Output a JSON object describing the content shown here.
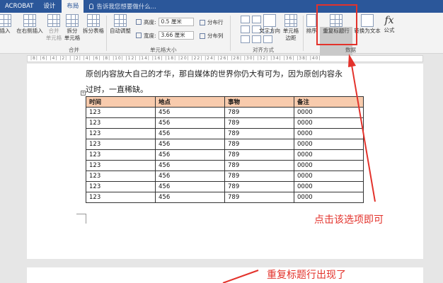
{
  "tabs": [
    {
      "label": "ACROBAT",
      "active": false
    },
    {
      "label": "设计",
      "active": false
    },
    {
      "label": "布局",
      "active": true
    }
  ],
  "search_placeholder": "告诉我您想要做什么...",
  "ribbon": {
    "insert_left": "插入",
    "insert_right": "在右侧插入",
    "merge_cells": [
      "合并",
      "单元格"
    ],
    "split_cells": [
      "拆分",
      "单元格"
    ],
    "split_table": "拆分表格",
    "group_merge": "合并",
    "autofit": "自动调整",
    "height_label": "高度:",
    "height_value": "0.5 厘米",
    "width_label": "宽度:",
    "width_value": "3.66 厘米",
    "distribute_rows": "分布行",
    "distribute_cols": "分布列",
    "group_cell_size": "单元格大小",
    "text_direction": "文字方向",
    "cell_margins": [
      "单元格",
      "边距"
    ],
    "group_alignment": "对齐方式",
    "sort": "排序",
    "repeat_header": "重复标题行",
    "convert_text": "转换为文本",
    "formula": "公式",
    "formula_glyph": "fx",
    "group_data": "数据"
  },
  "document": {
    "line1": "原创内容放大自己的才华，那自媒体的世界你仍大有可为，因为原创内容永",
    "line2": "过时，一直稀缺。",
    "table": {
      "headers": [
        "时间",
        "地点",
        "事物",
        "备注"
      ],
      "rows": [
        [
          "123",
          "456",
          "789",
          "0000"
        ],
        [
          "123",
          "456",
          "789",
          "0000"
        ],
        [
          "123",
          "456",
          "789",
          "0000"
        ],
        [
          "123",
          "456",
          "789",
          "0000"
        ],
        [
          "123",
          "456",
          "789",
          "0000"
        ],
        [
          "123",
          "456",
          "789",
          "0000"
        ],
        [
          "123",
          "456",
          "789",
          "0000"
        ],
        [
          "123",
          "456",
          "789",
          "0000"
        ],
        [
          "123",
          "456",
          "789",
          "0000"
        ]
      ]
    }
  },
  "annotations": {
    "click_hint": "点击该选项即可",
    "result_hint": "重复标题行出现了"
  },
  "colors": {
    "accent": "#2b579a",
    "header_fill": "#f8cbad",
    "annotation": "#e3322b"
  }
}
